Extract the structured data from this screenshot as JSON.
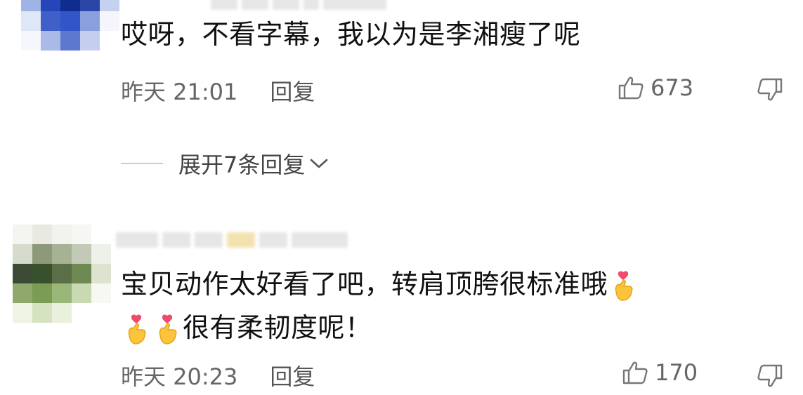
{
  "comments": [
    {
      "text": "哎呀，不看字幕，我以为是李湘瘦了呢",
      "time": "昨天 21:01",
      "reply_label": "回复",
      "likes": "673",
      "expand_label": "展开7条回复"
    },
    {
      "text_line1": "宝贝动作太好看了吧，转肩顶胯很标准哦",
      "text_line2": "很有柔韧度呢！",
      "time": "昨天 20:23",
      "reply_label": "回复",
      "likes": "170"
    }
  ],
  "icons": {
    "like": "thumbs-up-icon",
    "dislike": "thumbs-down-icon",
    "expand": "chevron-down-icon",
    "emoji": "finger-heart-emoji"
  },
  "colors": {
    "text": "#111111",
    "meta": "#666666"
  }
}
